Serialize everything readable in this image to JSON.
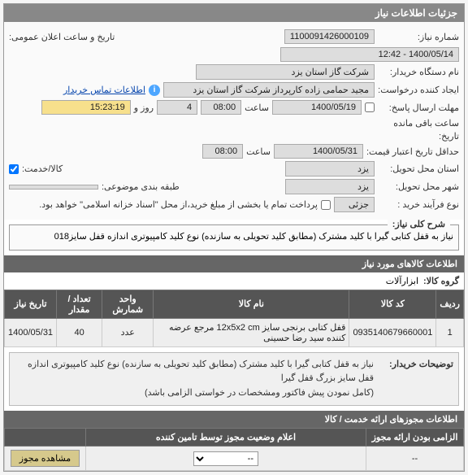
{
  "panel": {
    "title": "جزئیات اطلاعات نیاز"
  },
  "form": {
    "need_no_lbl": "شماره نیاز:",
    "need_no": "1100091426000109",
    "pub_date_lbl": "تاریخ و ساعت اعلان عمومی:",
    "pub_date": "1400/05/14 - 12:42",
    "buyer_lbl": "نام دستگاه خریدار:",
    "buyer": "شرکت گاز استان یزد",
    "requester_lbl": "ایجاد کننده درخواست:",
    "requester": "مجید حمامی زاده کارپرداز شرکت گاز استان یزد",
    "contact_lbl": "اطلاعات تماس خریدار",
    "send_deadline_lbl": "مهلت ارسال پاسخ:",
    "send_deadline_date": "1400/05/19",
    "time_lbl": "ساعت",
    "send_deadline_time": "08:00",
    "days_lbl": "روز و",
    "days_val": "4",
    "remain_lbl": "ساعت باقی مانده",
    "remain_time": "15:23:19",
    "history_lbl": "تاریخ:",
    "valid_lbl": "حداقل تاریخ اعتبار قیمت:",
    "valid_date": "1400/05/31",
    "valid_time": "08:00",
    "need_loc_lbl": "استان محل تحویل:",
    "need_loc": "یزد",
    "item_lbl": "کالا/خدمت:",
    "city_lbl": "شهر محل تحویل:",
    "city": "یزد",
    "class_lbl": "طبقه بندی موضوعی:",
    "purchase_type_lbl": "نوع فرآیند خرید :",
    "purchase_type": "جزئی",
    "pay_note": "پرداخت تمام یا بخشی از مبلغ خرید،از محل \"اسناد خزانه اسلامی\" خواهد بود.",
    "desc_title": "شرح کلی نیاز:",
    "desc_text": "نیاز به قفل کتابی گیرا با کلید مشترک (مطابق کلید تحویلی به سازنده) نوع کلید کامپیوتری اندازه قفل سایز018"
  },
  "items": {
    "title": "اطلاعات کالاهای مورد نیاز",
    "group_lbl": "گروه کالا:",
    "group_val": "ابزارآلات",
    "cols": {
      "row": "ردیف",
      "code": "کد کالا",
      "name": "نام کالا",
      "unit": "واحد شمارش",
      "qty": "تعداد / مقدار",
      "date": "تاریخ نیاز"
    },
    "r1": {
      "row": "1",
      "code": "0935140679660001",
      "name": "قفل کتابی برنجی سایز 12x5x2 cm مرجع عرضه کننده سید رضا حسینی",
      "unit": "عدد",
      "qty": "40",
      "date": "1400/05/31"
    }
  },
  "buyer_note": {
    "lbl": "توضیحات خریدار:",
    "line1": "نیاز به قفل کتابی گیرا با کلید مشترک (مطابق کلید تحویلی به سازنده) نوع کلید کامپیوتری اندازه قفل سایز بزرگ قفل گیرا",
    "line2": "(کامل نمودن پیش فاکتور ومشخصات در خواستی الزامی باشد)"
  },
  "auth": {
    "title": "اطلاعات مجوزهای ارائه خدمت / کالا",
    "status_title": "اعلام وضعیت مجوز توسط تامین کننده",
    "mandatory_lbl": "الزامی بودن ارائه مجوز",
    "view_btn": "مشاهده مجوز",
    "sel_placeholder": "--"
  }
}
